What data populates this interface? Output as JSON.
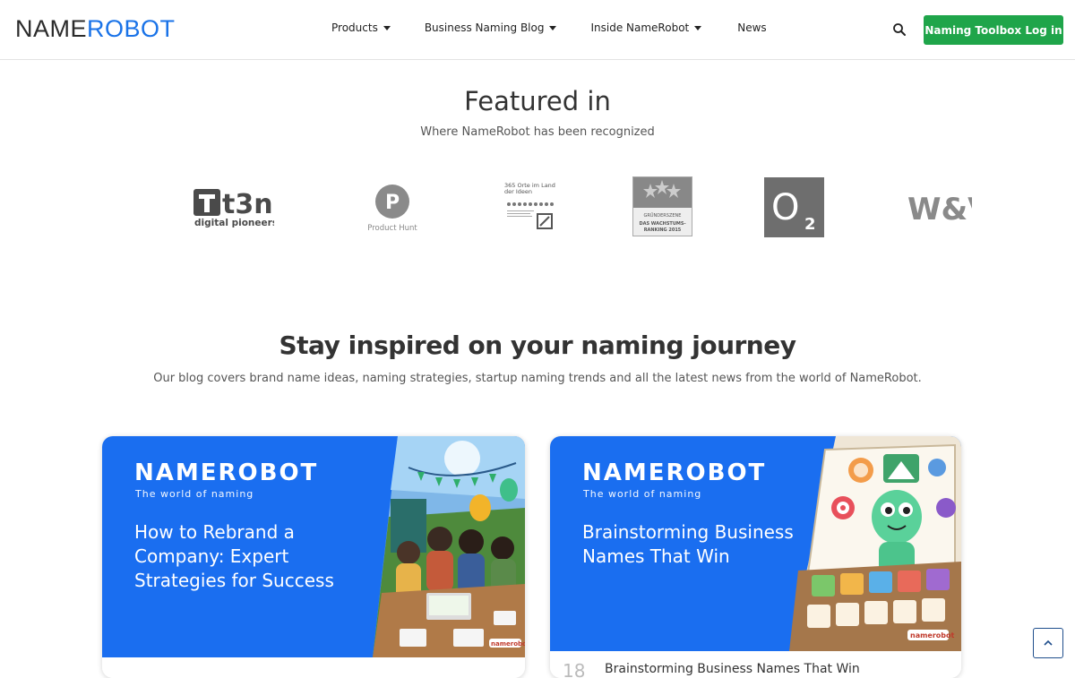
{
  "header": {
    "logo_part1": "NAME",
    "logo_part2": "ROBOT",
    "nav": [
      {
        "label": "Products"
      },
      {
        "label": "Business Naming Blog"
      },
      {
        "label": "Inside NameRobot"
      },
      {
        "label": "News"
      }
    ],
    "login_label": "Naming Toolbox Log in",
    "search_icon": "search-icon"
  },
  "featured": {
    "title": "Featured in",
    "subtitle": "Where NameRobot has been recognized",
    "logos": [
      {
        "name": "t3n",
        "text": "t3n",
        "sub": "digital pioneers"
      },
      {
        "name": "Product Hunt",
        "letter": "P",
        "text": "Product Hunt"
      },
      {
        "name": "365 Orte im Land der Ideen",
        "text": "365 Orte im Land der Ideen"
      },
      {
        "name": "Gründerszene",
        "line1": "GRÜNDERSZENE",
        "line2": "DAS WACHSTUMS-",
        "line3": "RANKING 2015"
      },
      {
        "name": "O2",
        "text": "O",
        "sub": "2"
      },
      {
        "name": "W&V",
        "text": "W&V"
      }
    ]
  },
  "blog": {
    "title": "Stay inspired on your naming journey",
    "subtitle": "Our blog covers brand name ideas, naming strategies, startup naming trends and all the latest news from the world of NameRobot.",
    "cards": [
      {
        "brand": "NAMEROBOT",
        "tagline": "The world of naming",
        "headline": "How to Rebrand a Company: Expert Strategies for Success",
        "number": "",
        "footer_title": ""
      },
      {
        "brand": "NAMEROBOT",
        "tagline": "The world of naming",
        "headline": "Brainstorming Business Names That Win",
        "number": "18",
        "footer_title": "Brainstorming Business Names That Win"
      }
    ]
  },
  "colors": {
    "brand_blue": "#1a73e8",
    "card_blue": "#1a6ef0",
    "login_green": "#1fa54a"
  }
}
